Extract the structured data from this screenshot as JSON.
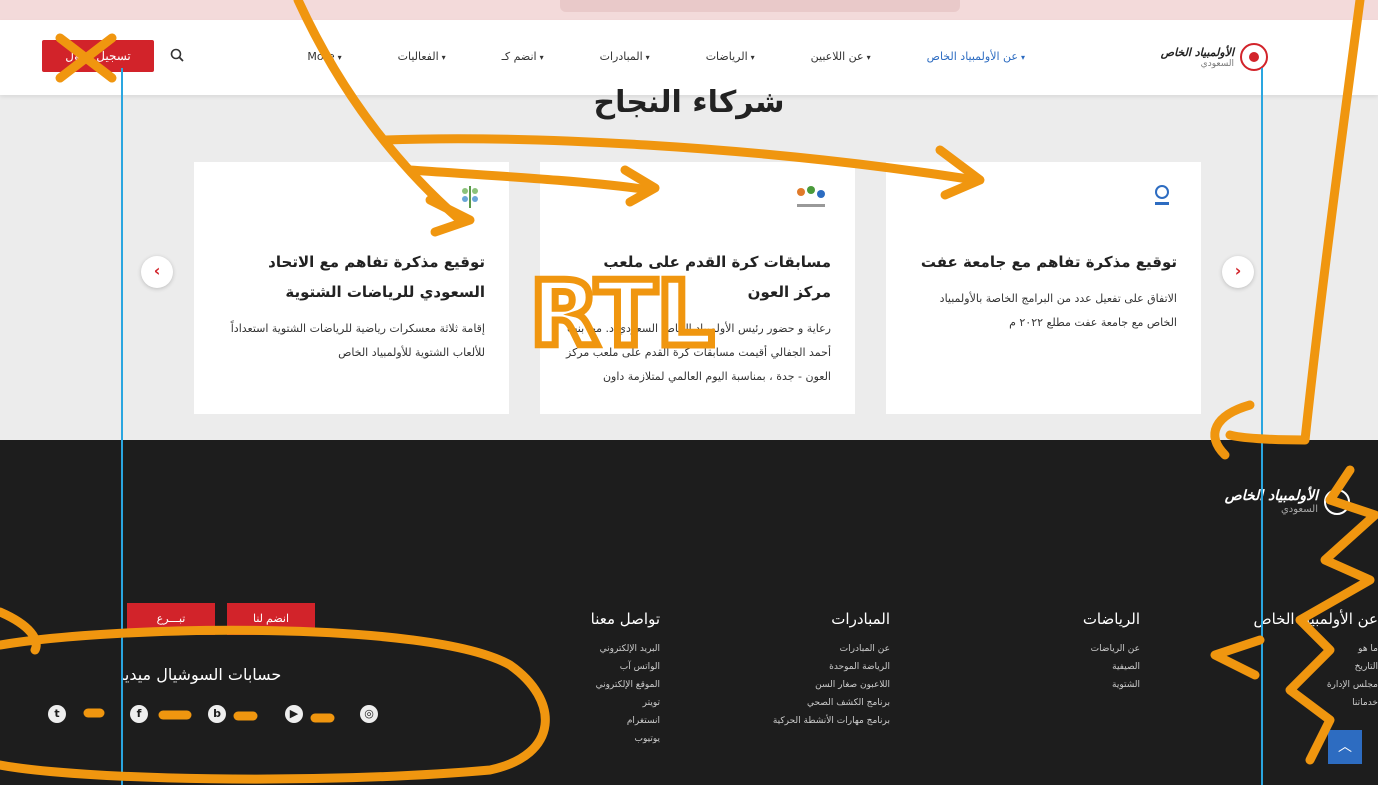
{
  "header": {
    "brand_title": "الأولمبياد الخاص",
    "brand_subtitle": "السعودي",
    "nav": [
      {
        "label": "عن الأولمبياد الخاص",
        "active": true
      },
      {
        "label": "عن اللاعبين",
        "active": false
      },
      {
        "label": "الرياضات",
        "active": false
      },
      {
        "label": "المبادرات",
        "active": false
      },
      {
        "label": "انضم كـ",
        "active": false
      },
      {
        "label": "الفعاليات",
        "active": false
      },
      {
        "label": "More",
        "active": false
      }
    ],
    "search_icon": "search-icon",
    "login_label": "تسجيل دخول"
  },
  "section": {
    "title": "شركاء النجاح"
  },
  "cards": [
    {
      "title": "توقيع مذكرة تفاهم مع جامعة عفت",
      "description": "الاتفاق على تفعيل عدد من البرامج الخاصة بالأولمبياد الخاص مع جامعة عفت مطلع ٢٠٢٢ م"
    },
    {
      "title": "مسابقات كرة القدم على ملعب مركز العون",
      "description": "رعاية و حضور رئيس الأولمبياد الخاص السعودي د. مها بنت أحمد الجفالي أقيمت مسابقات كرة القدم على ملعب مركز العون - جدة ، بمناسبة اليوم العالمي لمتلازمة داون"
    },
    {
      "title": "توقيع مذكرة تفاهم مع الاتحاد السعودي للرياضات الشتوية",
      "description": "إقامة ثلاثة معسكرات رياضية للرياضات الشتوية استعداداً للألعاب الشتوية للأولمبياد الخاص"
    }
  ],
  "carousel": {
    "next_icon": "chevron-right-icon",
    "prev_icon": "chevron-left-icon"
  },
  "footer": {
    "brand_title": "الأولمبياد الخاص",
    "brand_subtitle": "السعودي",
    "columns": [
      {
        "head": "عن الأولمبياد الخاص",
        "links": [
          "ما هو",
          "التاريخ",
          "مجلس الإدارة",
          "خدماتنا"
        ]
      },
      {
        "head": "الرياضات",
        "links": [
          "عن الرياضات",
          "الصيفية",
          "الشتوية"
        ]
      },
      {
        "head": "المبادرات",
        "links": [
          "عن المبادرات",
          "الرياضة الموحدة",
          "اللاعبون صغار السن",
          "برنامج الكشف الصحي",
          "برنامج مهارات الأنشطة الحركية"
        ]
      },
      {
        "head": "تواصل معنا",
        "links": [
          "البريد الإلكتروني",
          "الواتس آب",
          "الموقع الإلكتروني",
          "تويتر",
          "انستغرام",
          "يوتيوب"
        ]
      }
    ],
    "join_label": "انضم لنا",
    "donate_label": "تبـــرع",
    "social_title": "حسابات السوشيال ميديا",
    "social_icons": [
      "twitter-icon",
      "facebook-icon",
      "blogger-icon",
      "youtube-icon",
      "instagram-icon"
    ]
  },
  "annotations": {
    "rtl_label": "RTL"
  },
  "colors": {
    "accent": "#d2232a",
    "link": "#2d6cc1",
    "footer_bg": "#1d1d1d",
    "annotation": "#f0960f",
    "guide": "#2aa6e0"
  }
}
